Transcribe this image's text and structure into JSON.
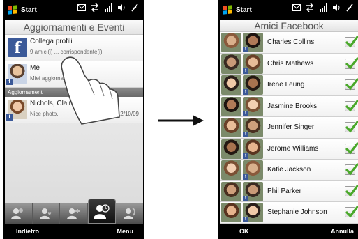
{
  "status_bar": {
    "start_label": "Start"
  },
  "left_screen": {
    "title": "Aggiornamenti e Eventi",
    "items": [
      {
        "title": "Collega profili",
        "subtitle": "9 amici(i) ... corrispondente(i)"
      },
      {
        "title": "Me",
        "subtitle": "Miei aggiornam..."
      }
    ],
    "section_header": "Aggiornamenti",
    "updates": [
      {
        "title": "Nichols, Claire",
        "subtitle": "Nice photo.",
        "date": "12/10/09"
      }
    ],
    "softkeys": {
      "left": "Indietro",
      "right": "Menu"
    },
    "colors": {
      "facebook": "#3b5998"
    }
  },
  "right_screen": {
    "title": "Amici Facebook",
    "friends": [
      {
        "name": "Charles Collins",
        "checked": true
      },
      {
        "name": "Chris Mathews",
        "checked": true
      },
      {
        "name": "Irene Leung",
        "checked": true
      },
      {
        "name": "Jasmine Brooks",
        "checked": true
      },
      {
        "name": "Jennifer Singer",
        "checked": true
      },
      {
        "name": "Jerome Williams",
        "checked": true
      },
      {
        "name": "Katie Jackson",
        "checked": true
      },
      {
        "name": "Phil Parker",
        "checked": true
      },
      {
        "name": "Stephanie Johnson",
        "checked": true
      }
    ],
    "softkeys": {
      "left": "OK",
      "right": "Annulla"
    },
    "colors": {
      "check": "#4aa82a"
    }
  }
}
